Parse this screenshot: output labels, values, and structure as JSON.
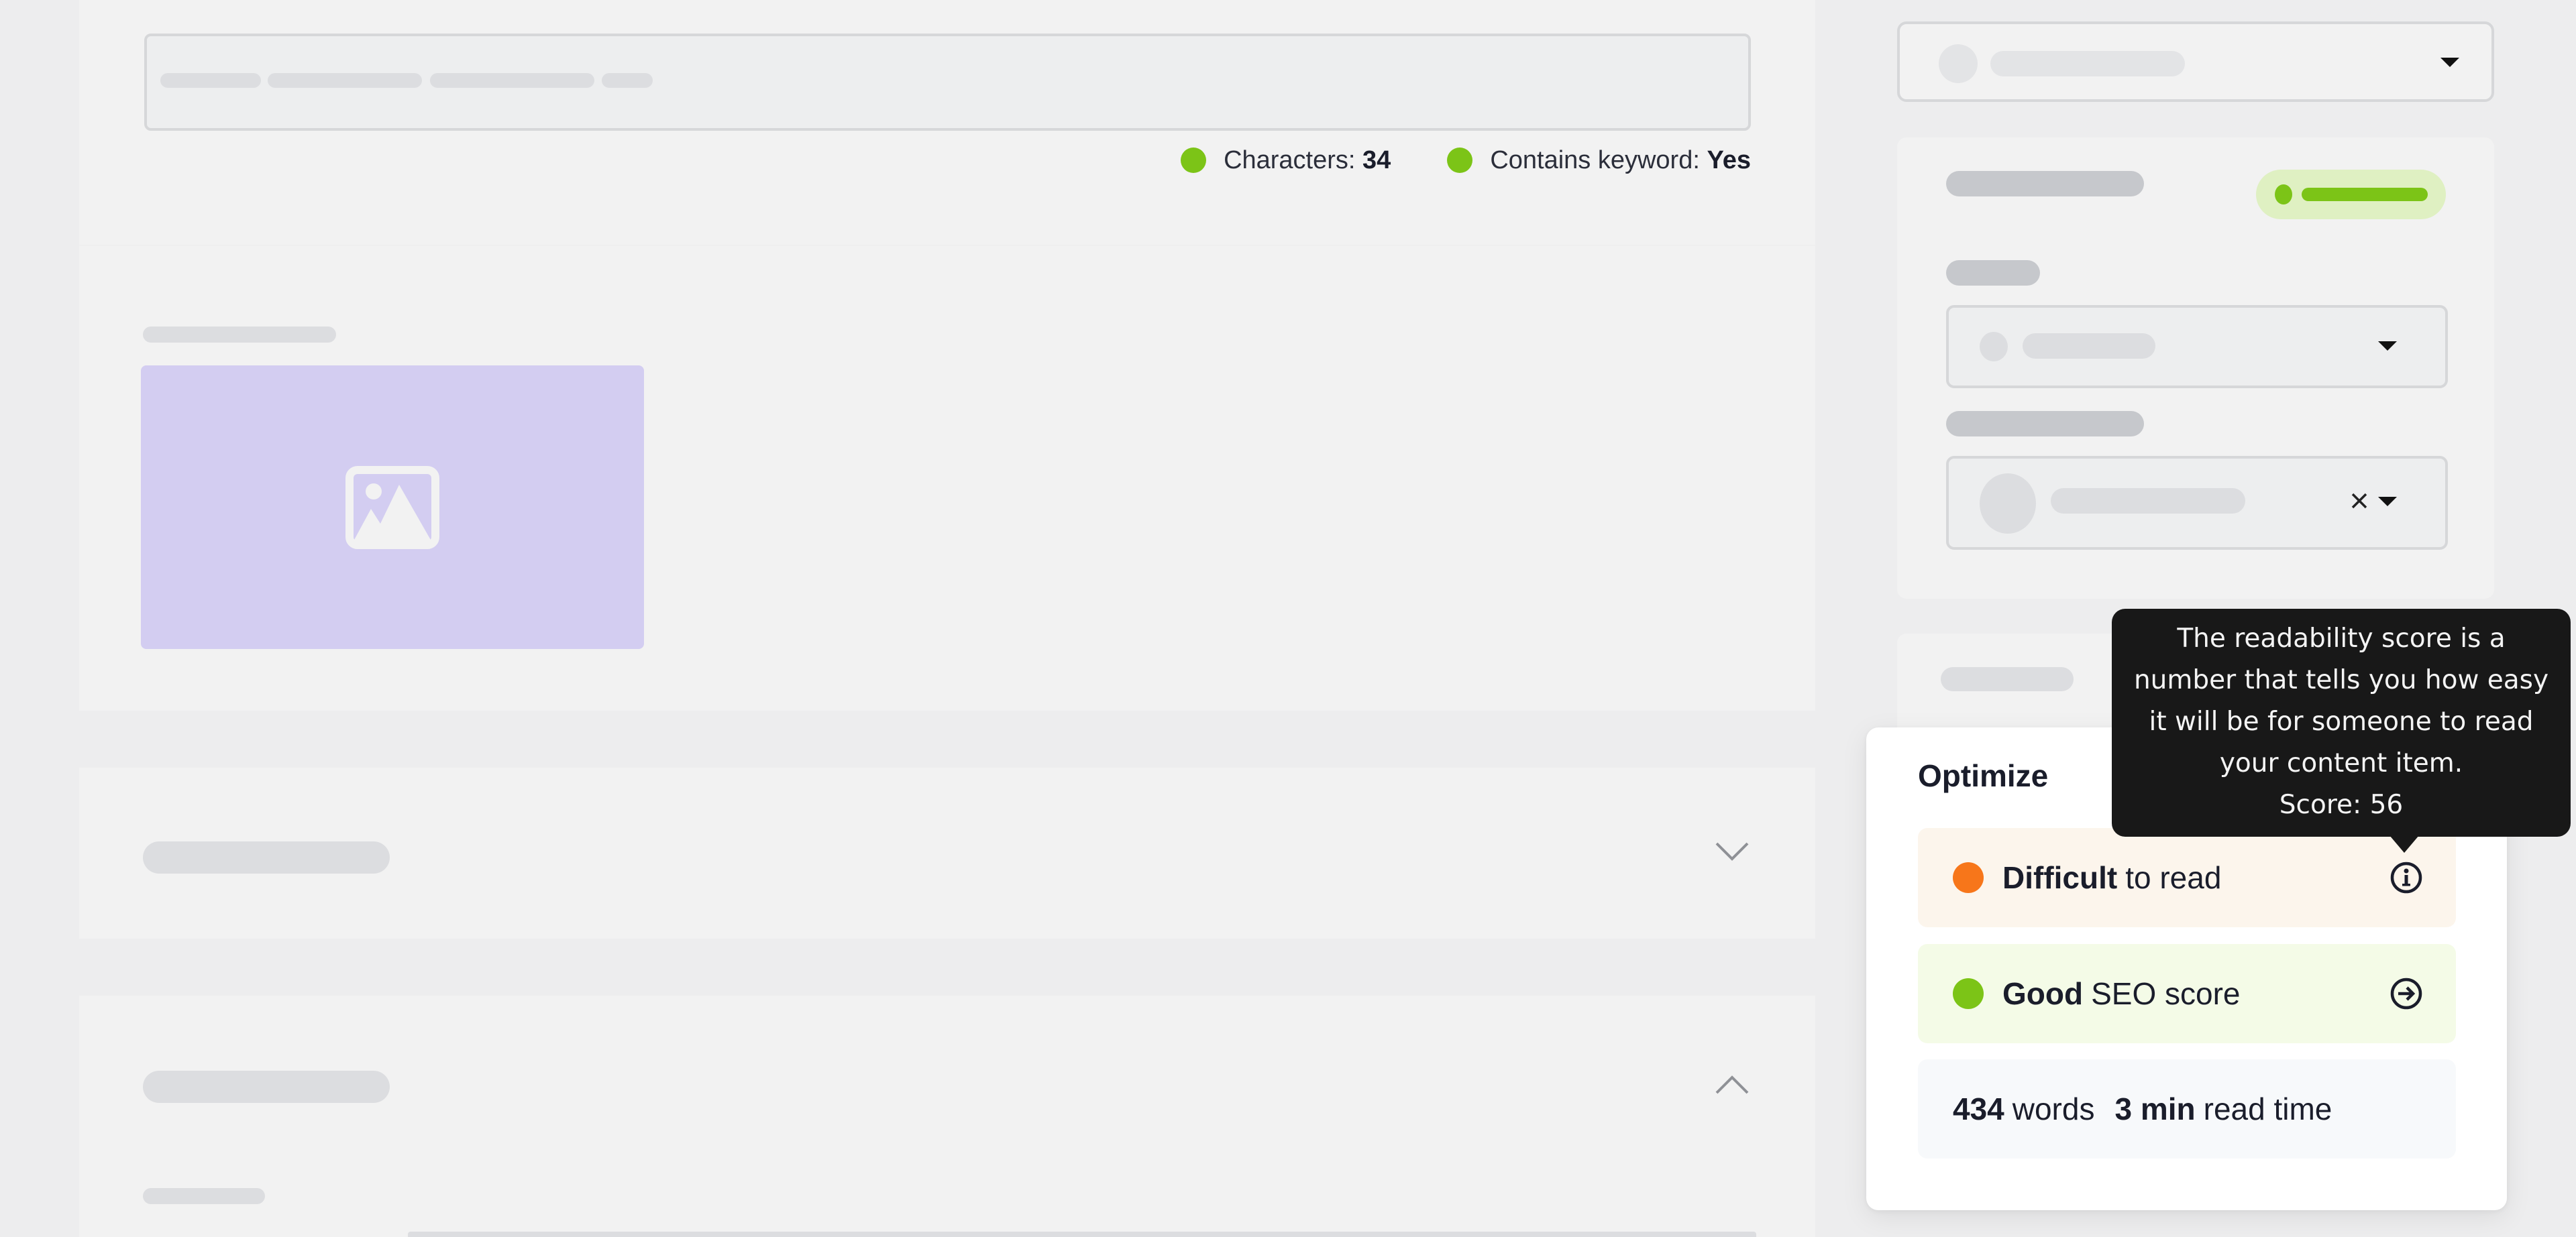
{
  "title_section": {
    "indicators": [
      {
        "label": "Characters:",
        "value": "34",
        "status": "good"
      },
      {
        "label": "Contains keyword:",
        "value": "Yes",
        "status": "good"
      }
    ]
  },
  "image_section": {
    "placeholder_icon": "image-icon"
  },
  "accordions": [
    {
      "state": "collapsed",
      "icon": "chevron-down-icon"
    },
    {
      "state": "expanded",
      "icon": "chevron-up-icon"
    }
  ],
  "sidebar": {
    "select_icon": "caret-down-icon",
    "clear_icon": "close-icon"
  },
  "optimize": {
    "title": "Optimize",
    "readability": {
      "strong": "Difficult",
      "text": "to read",
      "icon": "info-icon",
      "status": "warning"
    },
    "seo": {
      "strong": "Good",
      "text": "SEO score",
      "icon": "arrow-right-circle-icon",
      "status": "good"
    },
    "stats": {
      "words_value": "434",
      "words_label": "words",
      "time_value": "3 min",
      "time_label": "read time"
    }
  },
  "tooltip": {
    "lines": [
      "The readability score is a",
      "number that tells you how easy",
      "it will be for someone to read",
      "your content item."
    ],
    "score_label": "Score: 56",
    "score": 56
  },
  "colors": {
    "good": "#7cc417",
    "warning": "#f7761a",
    "placeholder_image": "#d3cdf1",
    "tooltip_bg": "#181818"
  }
}
